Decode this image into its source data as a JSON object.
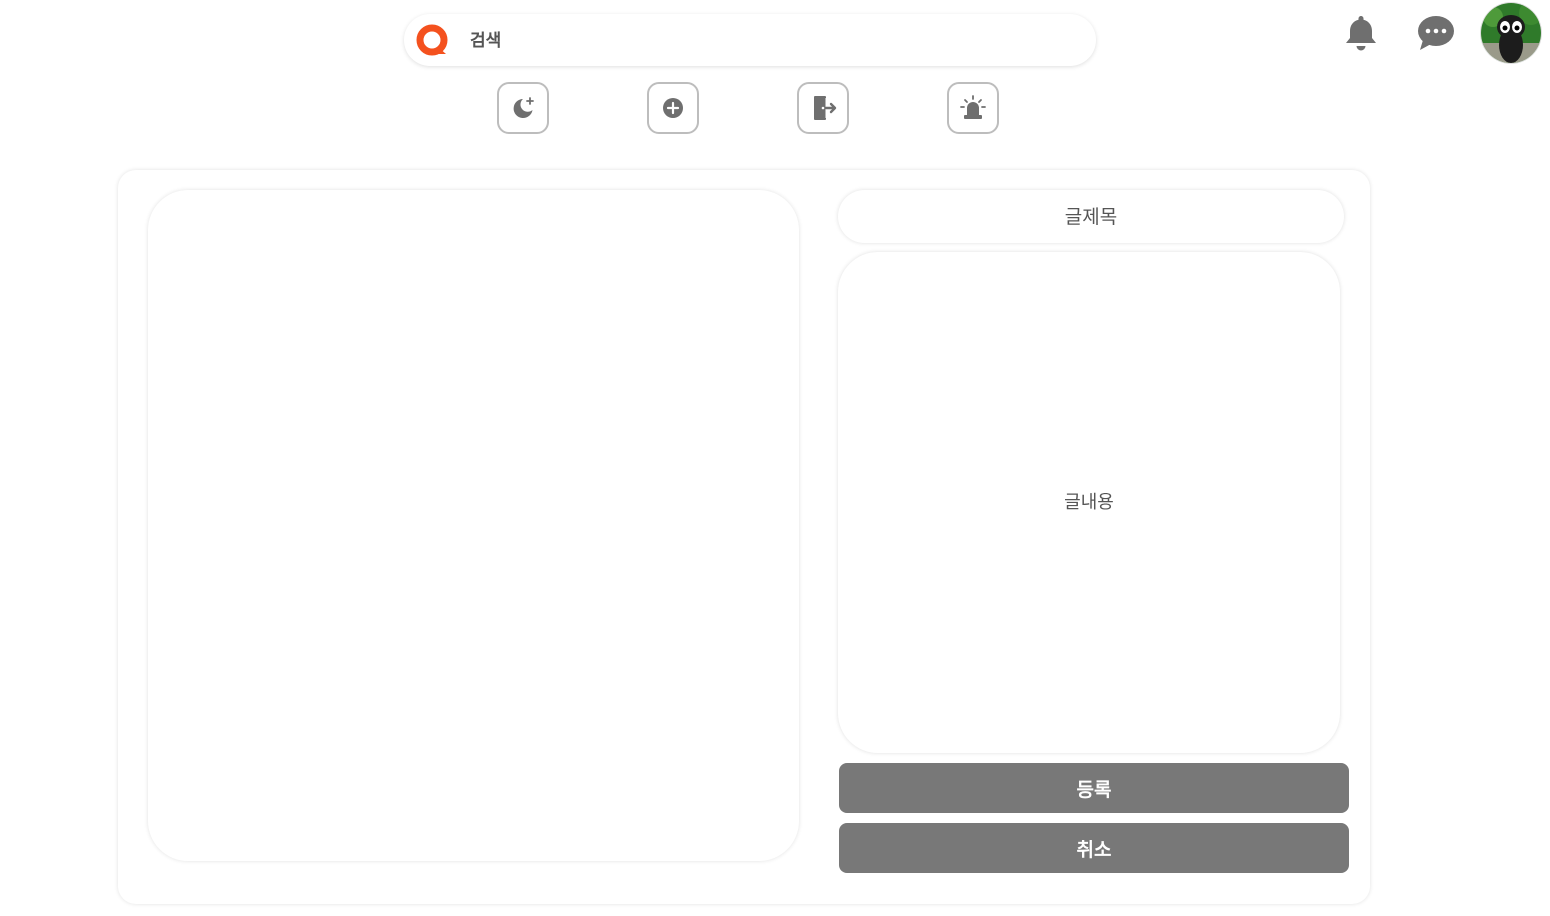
{
  "search": {
    "placeholder": "검색",
    "logo_icon": "brand-logo-icon"
  },
  "header_icons": [
    "bell-icon",
    "chat-bubble-icon",
    "user-avatar"
  ],
  "toolbar": [
    {
      "icon": "dark-mode-moon-icon"
    },
    {
      "icon": "add-circle-icon"
    },
    {
      "icon": "logout-door-icon"
    },
    {
      "icon": "siren-alert-icon"
    }
  ],
  "form": {
    "title_placeholder": "글제목",
    "content_placeholder": "글내용",
    "submit_label": "등록",
    "cancel_label": "취소"
  },
  "colors": {
    "brand_accent": "#f4511e",
    "icon_gray": "#6f6f6f",
    "button_gray": "#787878",
    "border_gray": "#bdbdbd"
  }
}
